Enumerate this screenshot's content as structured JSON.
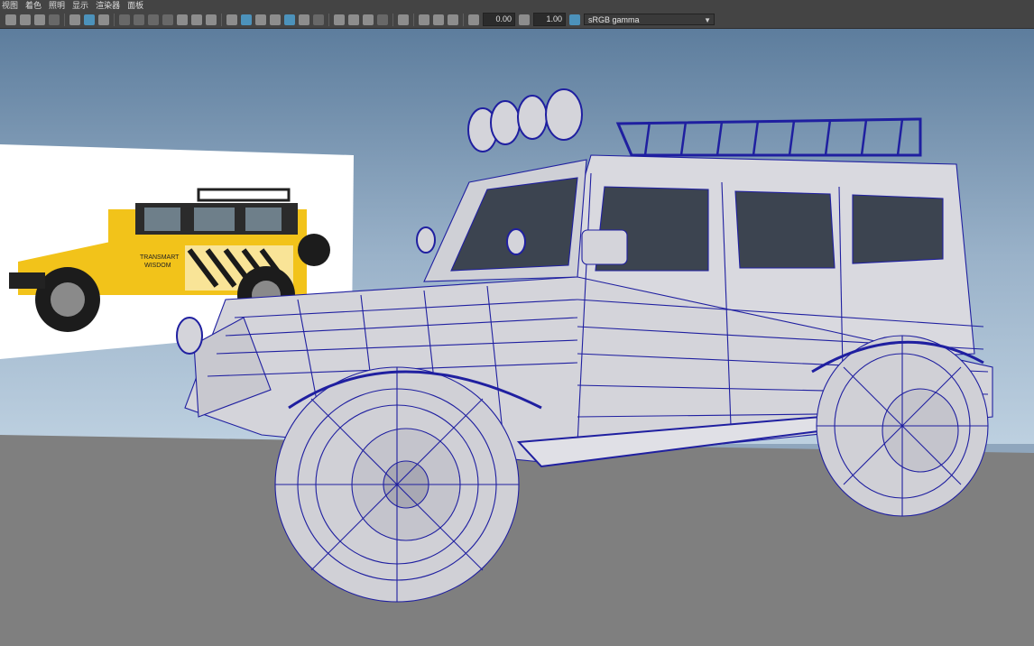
{
  "menu": [
    "视图",
    "着色",
    "照明",
    "显示",
    "渲染器",
    "面板"
  ],
  "toolbar": {
    "field1": "0.00",
    "field2": "1.00",
    "color_space": "sRGB gamma"
  },
  "colors": {
    "toolbar_bg": "#444444",
    "sky_top": "#5f7f9e",
    "sky_bottom": "#b7cadc",
    "ground": "#7f7f7f",
    "wire": "#1f1fa0",
    "ref_car": "#f3c51a"
  },
  "reference_image": {
    "caption": "TRANSMART WISDOM"
  }
}
